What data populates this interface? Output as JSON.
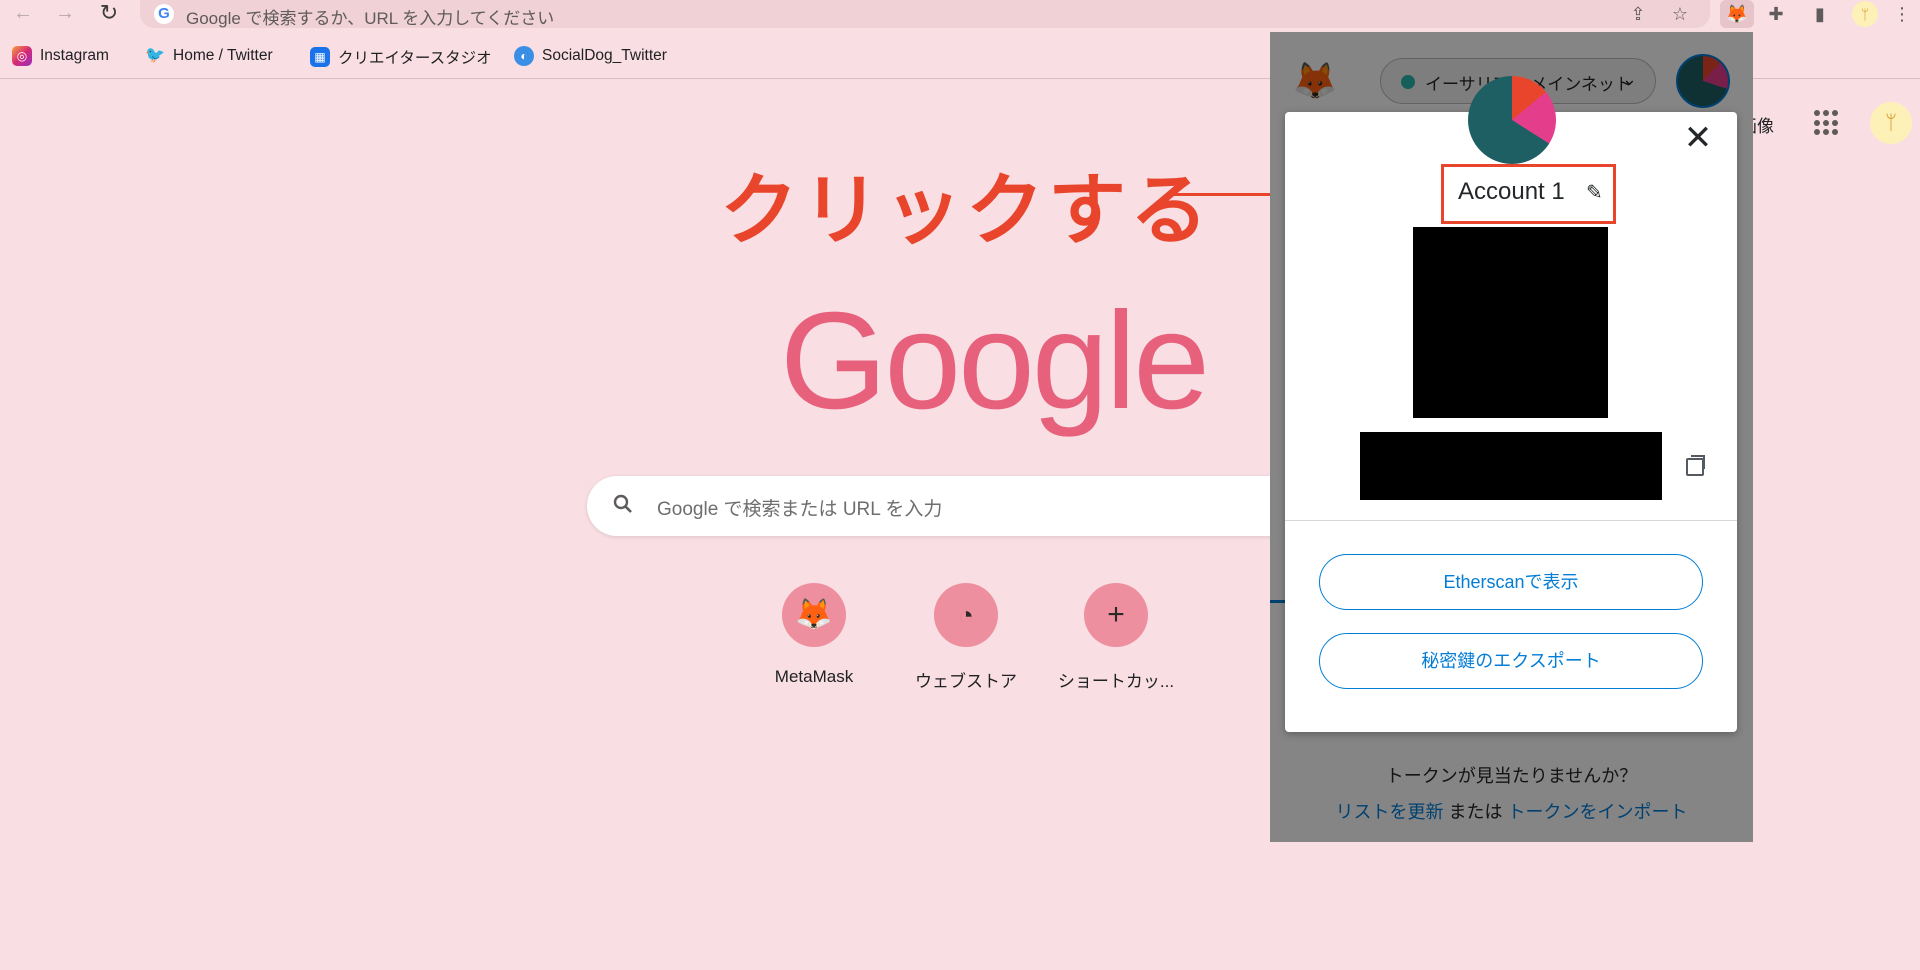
{
  "browser": {
    "omnibox_placeholder": "Google で検索するか、URL を入力してください",
    "bookmarks": [
      {
        "label": "Instagram"
      },
      {
        "label": "Home / Twitter"
      },
      {
        "label": "クリエイタースタジオ"
      },
      {
        "label": "SocialDog_Twitter"
      }
    ]
  },
  "page": {
    "annotation": "クリックする",
    "logo": "Google",
    "search_placeholder": "Google で検索または URL を入力",
    "images_link": "画像",
    "shortcuts": [
      {
        "label": "MetaMask",
        "icon": "fox-icon"
      },
      {
        "label": "ウェブストア",
        "icon": "webstore-icon"
      },
      {
        "label": "ショートカッ...",
        "icon": "plus-icon"
      }
    ]
  },
  "metamask": {
    "network": "イーサリアム メインネット",
    "account_name": "Account 1",
    "buttons": {
      "etherscan": "Etherscanで表示",
      "export_key": "秘密鍵のエクスポート"
    },
    "token_question": "トークンが見当たりませんか？",
    "refresh_link": "リストを更新",
    "or_text": "または",
    "import_link": "トークンをインポート"
  },
  "colors": {
    "page_bg": "#f9dfe3",
    "annotation": "#e8452c",
    "google_logo": "#e8617c",
    "metamask_blue": "#037dd6"
  }
}
